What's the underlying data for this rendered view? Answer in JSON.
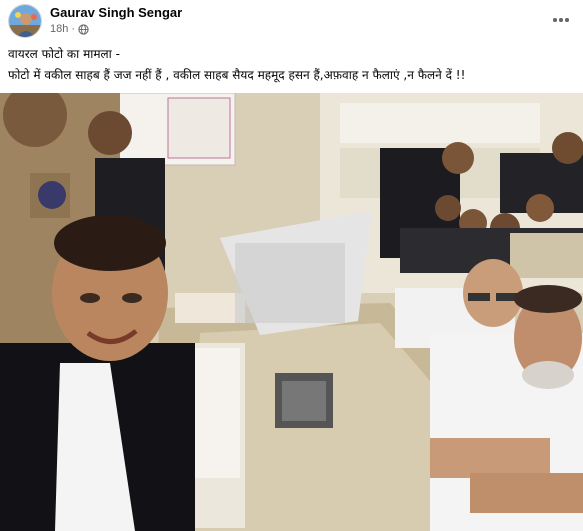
{
  "post": {
    "author": "Gaurav Singh Sengar",
    "time": "18h",
    "privacy_icon": "globe-icon",
    "more_icon": "more-options-icon",
    "caption_line1": "वायरल फोटो का मामला -",
    "caption_line2": "फोटो में वकील साहब हैं जज नहीं हैं , वकील साहब सैयद महमूद हसन हैं,अफ़वाह न फैलाएं ,न फैलने दें !!"
  },
  "photo": {
    "image_icon": "court-selfie-photo"
  },
  "colors": {
    "text": "#050505",
    "meta": "#65676b"
  }
}
